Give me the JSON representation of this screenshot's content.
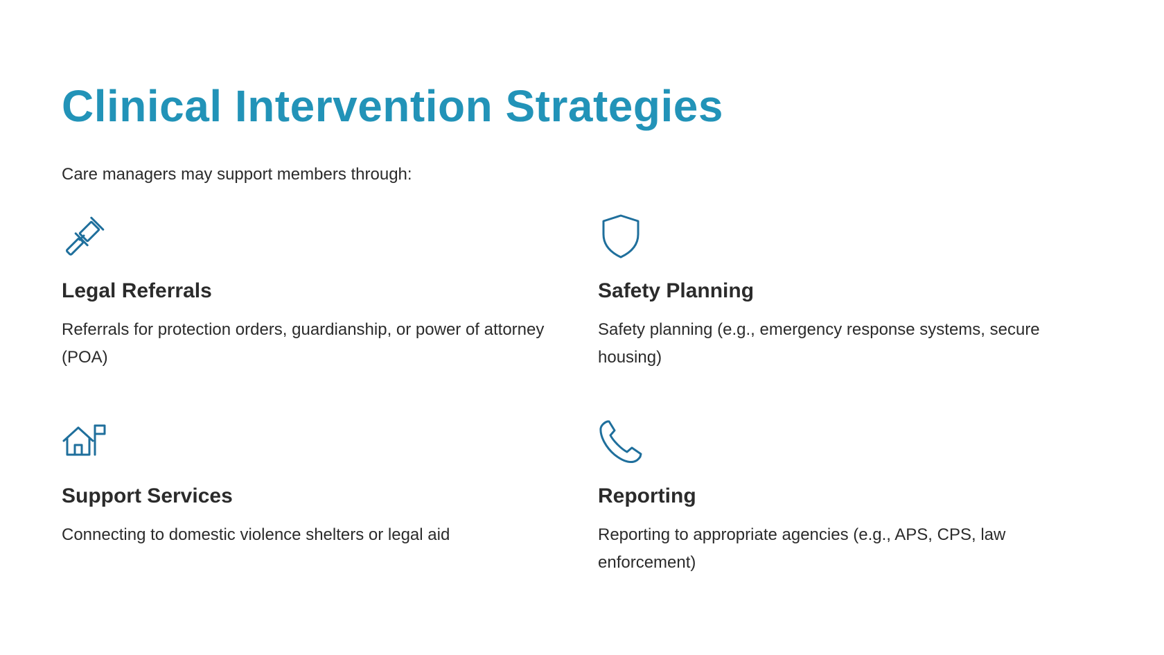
{
  "page": {
    "title": "Clinical Intervention Strategies",
    "intro": "Care managers may support members through:"
  },
  "colors": {
    "accent": "#2293b8",
    "icon": "#1f6f9c",
    "text": "#2b2b2b",
    "background": "#ffffff"
  },
  "items": [
    {
      "icon": "gavel-icon",
      "heading": "Legal Referrals",
      "description": "Referrals for protection orders, guardianship, or power of attorney (POA)"
    },
    {
      "icon": "shield-icon",
      "heading": "Safety Planning",
      "description": "Safety planning (e.g., emergency response systems, secure housing)"
    },
    {
      "icon": "house-flag-icon",
      "heading": "Support Services",
      "description": "Connecting to domestic violence shelters or legal aid"
    },
    {
      "icon": "phone-icon",
      "heading": "Reporting",
      "description": "Reporting to appropriate agencies (e.g., APS, CPS, law enforcement)"
    }
  ]
}
